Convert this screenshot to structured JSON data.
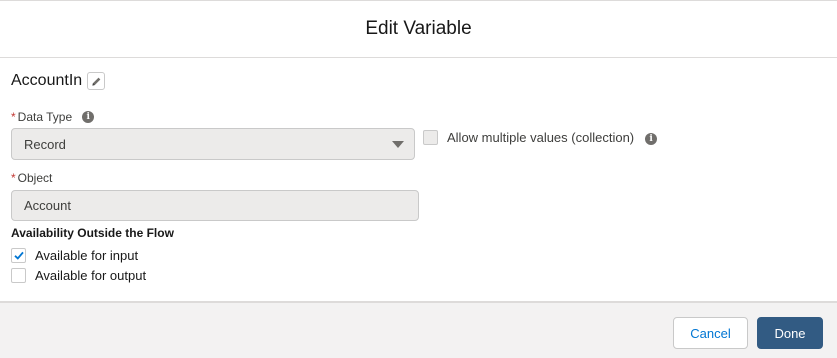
{
  "modal": {
    "title": "Edit Variable"
  },
  "variable": {
    "name": "AccountIn",
    "edit_icon": "pencil-icon"
  },
  "data_type": {
    "label": "Data Type",
    "required_marker": "*",
    "info_icon": "info-icon",
    "selected_value": "Record"
  },
  "collection": {
    "label": "Allow multiple values (collection)",
    "checked": false,
    "disabled": true,
    "info_icon": "info-icon"
  },
  "object": {
    "label": "Object",
    "required_marker": "*",
    "value": "Account"
  },
  "availability": {
    "heading": "Availability Outside the Flow",
    "options": [
      {
        "label": "Available for input",
        "checked": true
      },
      {
        "label": "Available for output",
        "checked": false
      }
    ]
  },
  "footer": {
    "cancel_label": "Cancel",
    "done_label": "Done",
    "done_color": "#325b83",
    "cancel_text_color": "#0176d3"
  }
}
